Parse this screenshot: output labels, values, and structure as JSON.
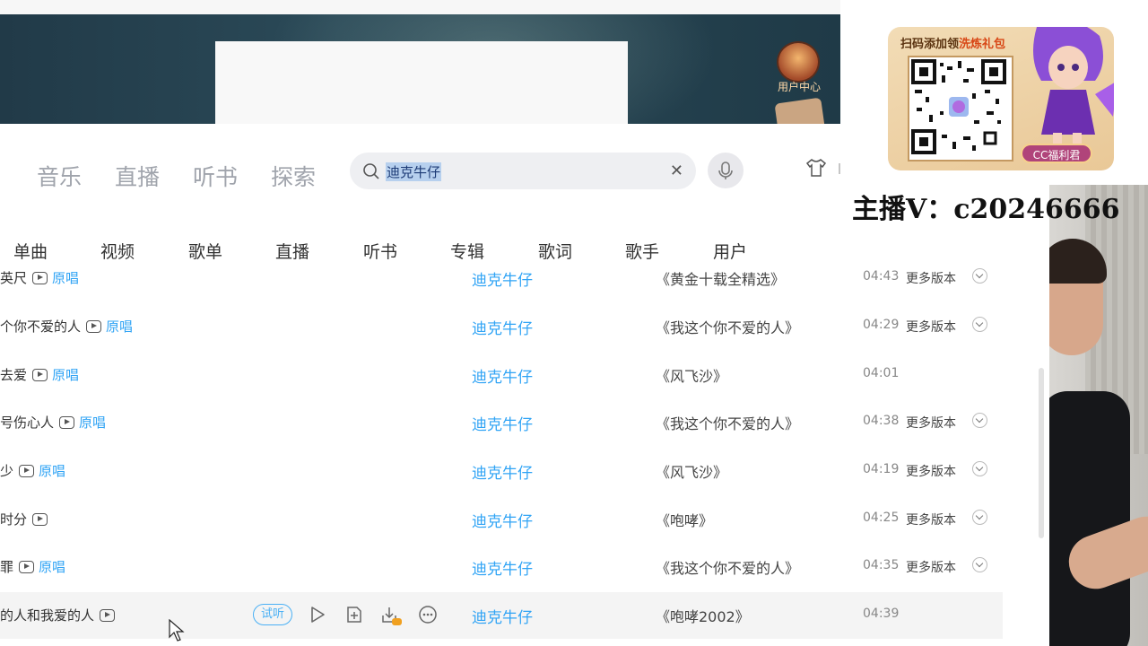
{
  "banner": {
    "user_center": "用户中心"
  },
  "topnav": [
    "音乐",
    "直播",
    "听书",
    "探索"
  ],
  "search": {
    "value": "迪克牛仔"
  },
  "subtabs": [
    "单曲",
    "视频",
    "歌单",
    "直播",
    "听书",
    "专辑",
    "歌词",
    "歌手",
    "用户"
  ],
  "rows": [
    {
      "title": "英尺",
      "orig": "原唱",
      "artist": "迪克牛仔",
      "album": "《黄金十载全精选》",
      "dur": "04:43",
      "more": "更多版本"
    },
    {
      "title": "个你不爱的人",
      "orig": "原唱",
      "artist": "迪克牛仔",
      "album": "《我这个你不爱的人》",
      "dur": "04:29",
      "more": "更多版本"
    },
    {
      "title": "去爱",
      "orig": "原唱",
      "artist": "迪克牛仔",
      "album": "《风飞沙》",
      "dur": "04:01",
      "more": ""
    },
    {
      "title": "号伤心人",
      "orig": "原唱",
      "artist": "迪克牛仔",
      "album": "《我这个你不爱的人》",
      "dur": "04:38",
      "more": "更多版本"
    },
    {
      "title": "少",
      "orig": "原唱",
      "artist": "迪克牛仔",
      "album": "《风飞沙》",
      "dur": "04:19",
      "more": "更多版本"
    },
    {
      "title": "时分",
      "orig": "",
      "artist": "迪克牛仔",
      "album": "《咆哮》",
      "dur": "04:25",
      "more": "更多版本"
    },
    {
      "title": "罪",
      "orig": "原唱",
      "artist": "迪克牛仔",
      "album": "《我这个你不爱的人》",
      "dur": "04:35",
      "more": "更多版本"
    },
    {
      "title": "的人和我爱的人",
      "orig": "",
      "artist": "迪克牛仔",
      "album": "《咆哮2002》",
      "dur": "04:39",
      "more": "",
      "trial": "试听"
    }
  ],
  "promo": {
    "title_a": "扫码添加领",
    "title_b": "洗炼礼包",
    "badge": "CC福利君"
  },
  "anchor": "主播V：c20246666",
  "colors": {
    "accent": "#31a4f5",
    "search_highlight": "#b7d0ee"
  }
}
